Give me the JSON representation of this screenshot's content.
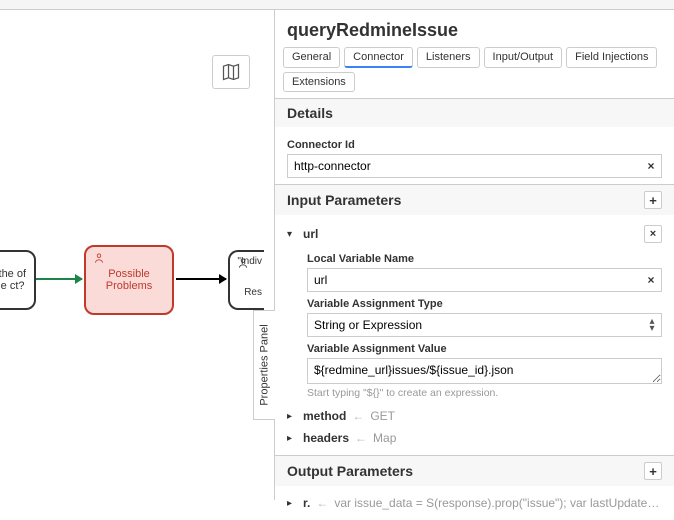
{
  "panel_title": "queryRedmineIssue",
  "tabs": [
    "General",
    "Connector",
    "Listeners",
    "Input/Output",
    "Field Injections",
    "Extensions"
  ],
  "active_tab": "Connector",
  "sidebar_label": "Properties Panel",
  "details": {
    "heading": "Details",
    "connector_id_label": "Connector Id",
    "connector_id_value": "http-connector"
  },
  "input_params": {
    "heading": "Input Parameters",
    "items": [
      {
        "name": "url",
        "expanded": true,
        "local_var_label": "Local Variable Name",
        "local_var_value": "url",
        "type_label": "Variable Assignment Type",
        "type_value": "String or Expression",
        "value_label": "Variable Assignment Value",
        "value_value": "${redmine_url}issues/${issue_id}.json",
        "hint": "Start typing \"${}\" to create an expression."
      },
      {
        "name": "method",
        "preview": "GET",
        "expanded": false
      },
      {
        "name": "headers",
        "preview": "Map",
        "expanded": false
      }
    ]
  },
  "output_params": {
    "heading": "Output Parameters",
    "items": [
      {
        "name": "r.",
        "preview": "var issue_data = S(response).prop(\"issue\"); var lastUpdatedDateStr =issue_…",
        "expanded": false
      }
    ]
  },
  "canvas": {
    "node_left_text": "s the of the ct?",
    "node_mid_text": "Possible Problems",
    "node_right_top": "\"Indiv",
    "node_right_bottom": "Res"
  }
}
